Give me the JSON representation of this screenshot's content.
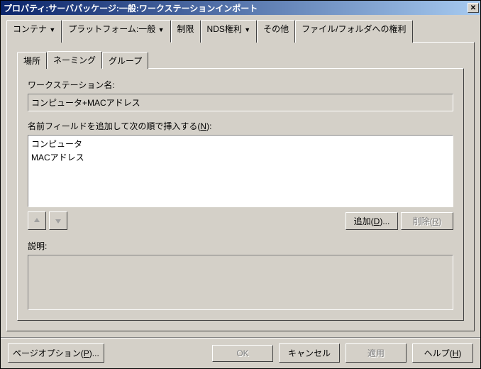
{
  "window": {
    "title": "プロパティ:サーバパッケージ:一般:ワークステーションインポート"
  },
  "outer_tabs": [
    {
      "label": "コンテナ",
      "dropdown": true
    },
    {
      "label": "プラットフォーム:一般",
      "dropdown": true,
      "active": true
    },
    {
      "label": "制限",
      "dropdown": false
    },
    {
      "label": "NDS権利",
      "dropdown": true
    },
    {
      "label": "その他",
      "dropdown": false
    },
    {
      "label": "ファイル/フォルダへの権利",
      "dropdown": false
    }
  ],
  "inner_tabs": [
    {
      "label": "場所"
    },
    {
      "label": "ネーミング",
      "active": true
    },
    {
      "label": "グループ"
    }
  ],
  "form": {
    "ws_name_label": "ワークステーション名:",
    "ws_name_value": "コンピュータ+MACアドレス",
    "fields_label_pre": "名前フィールドを追加して次の順で挿入する(",
    "fields_label_hotkey": "N",
    "fields_label_post": "):",
    "list_items": [
      "コンピュータ",
      "MACアドレス"
    ],
    "add_label_pre": "追加(",
    "add_hotkey": "D",
    "add_label_post": ")...",
    "remove_label_pre": "削除(",
    "remove_hotkey": "R",
    "remove_label_post": ")",
    "desc_label": "説明:"
  },
  "footer": {
    "page_options_pre": "ページオプション(",
    "page_options_hotkey": "P",
    "page_options_post": ")...",
    "ok": "OK",
    "cancel": "キャンセル",
    "apply": "適用",
    "help_pre": "ヘルプ(",
    "help_hotkey": "H",
    "help_post": ")"
  }
}
